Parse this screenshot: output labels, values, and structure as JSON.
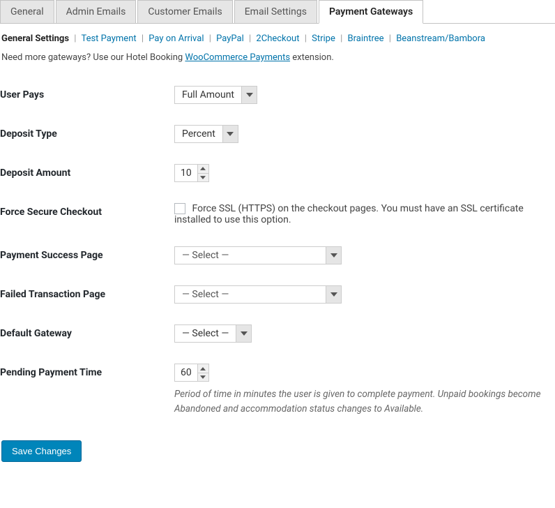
{
  "tabs": [
    {
      "label": "General"
    },
    {
      "label": "Admin Emails"
    },
    {
      "label": "Customer Emails"
    },
    {
      "label": "Email Settings"
    },
    {
      "label": "Payment Gateways",
      "active": true
    }
  ],
  "subtabs": {
    "current": "General Settings",
    "items": [
      "Test Payment",
      "Pay on Arrival",
      "PayPal",
      "2Checkout",
      "Stripe",
      "Braintree",
      "Beanstream/Bambora"
    ]
  },
  "notice": {
    "prefix": "Need more gateways? Use our Hotel Booking ",
    "link": "WooCommerce Payments",
    "suffix": " extension."
  },
  "fields": {
    "user_pays": {
      "label": "User Pays",
      "value": "Full Amount"
    },
    "deposit_type": {
      "label": "Deposit Type",
      "value": "Percent"
    },
    "deposit_amount": {
      "label": "Deposit Amount",
      "value": "10"
    },
    "force_secure": {
      "label": "Force Secure Checkout",
      "checkbox_label": "Force SSL (HTTPS) on the checkout pages. You must have an SSL certificate installed to use this option."
    },
    "success_page": {
      "label": "Payment Success Page",
      "value": "— Select —"
    },
    "failed_page": {
      "label": "Failed Transaction Page",
      "value": "— Select —"
    },
    "default_gateway": {
      "label": "Default Gateway",
      "value": "— Select —"
    },
    "pending_time": {
      "label": "Pending Payment Time",
      "value": "60",
      "description": "Period of time in minutes the user is given to complete payment. Unpaid bookings become Abandoned and accommodation status changes to Available."
    }
  },
  "save_label": "Save Changes"
}
